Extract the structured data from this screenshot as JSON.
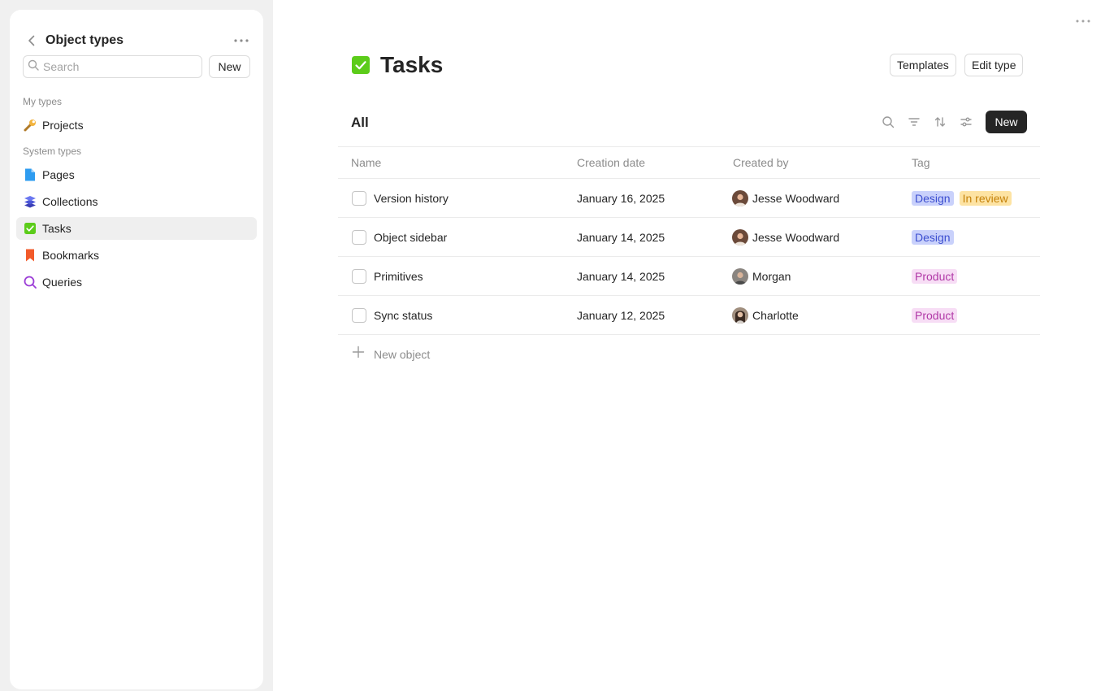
{
  "sidebar": {
    "title": "Object types",
    "search_placeholder": "Search",
    "new_label": "New",
    "my_types_label": "My types",
    "system_types_label": "System types",
    "my_types": [
      {
        "label": "Projects",
        "icon": "wrench-icon"
      }
    ],
    "system_types": [
      {
        "label": "Pages",
        "icon": "page-icon"
      },
      {
        "label": "Collections",
        "icon": "layers-icon"
      },
      {
        "label": "Tasks",
        "icon": "checkbox-icon",
        "active": true
      },
      {
        "label": "Bookmarks",
        "icon": "bookmark-icon"
      },
      {
        "label": "Queries",
        "icon": "search-icon"
      }
    ]
  },
  "main": {
    "title": "Tasks",
    "templates_label": "Templates",
    "edit_type_label": "Edit type",
    "view_title": "All",
    "new_label": "New",
    "columns": [
      "Name",
      "Creation date",
      "Created by",
      "Tag"
    ],
    "rows": [
      {
        "name": "Version history",
        "date": "January 16, 2025",
        "creator": "Jesse Woodward",
        "tags": [
          "Design",
          "In review"
        ]
      },
      {
        "name": "Object sidebar",
        "date": "January 14, 2025",
        "creator": "Jesse Woodward",
        "tags": [
          "Design"
        ]
      },
      {
        "name": "Primitives",
        "date": "January 14, 2025",
        "creator": "Morgan",
        "tags": [
          "Product"
        ]
      },
      {
        "name": "Sync status",
        "date": "January 12, 2025",
        "creator": "Charlotte",
        "tags": [
          "Product"
        ]
      }
    ],
    "new_object_label": "New object"
  },
  "colors": {
    "accent_dark": "#252525",
    "tasks_green": "#5ccc1a",
    "tag_design_bg": "#c9d1fb",
    "tag_design_fg": "#3d4fd0",
    "tag_review_bg": "#fde3a3",
    "tag_review_fg": "#c5820a",
    "tag_product_bg": "#f7ddf5",
    "tag_product_fg": "#b038a6"
  }
}
